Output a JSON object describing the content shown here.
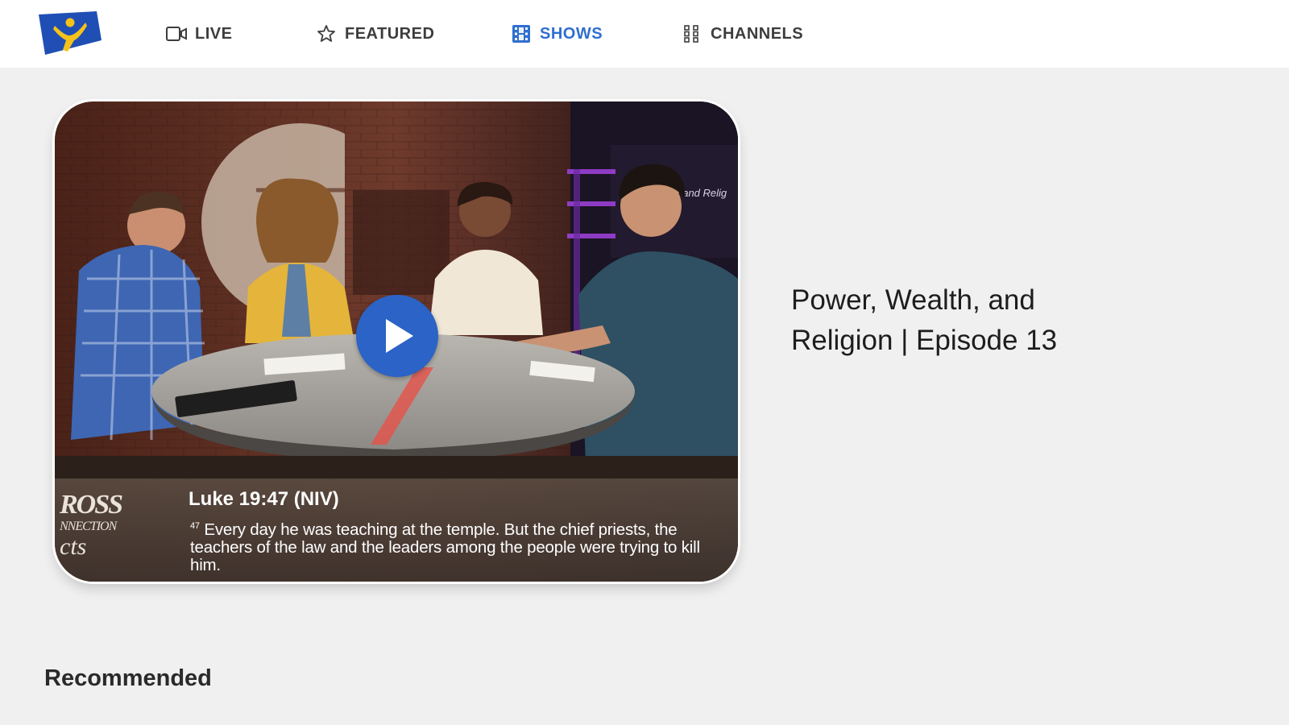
{
  "nav": {
    "logo_icon": "network-logo-icon",
    "items": [
      {
        "label": "LIVE",
        "icon": "video-camera-icon",
        "active": false
      },
      {
        "label": "FEATURED",
        "icon": "star-icon",
        "active": false
      },
      {
        "label": "SHOWS",
        "icon": "film-icon",
        "active": true
      },
      {
        "label": "CHANNELS",
        "icon": "grid-icon",
        "active": false
      }
    ],
    "active_color": "#2f6fd0",
    "text_color": "#3d3d3d"
  },
  "hero": {
    "caption": {
      "brand_line1": "ROSS",
      "brand_line2": "NNECTION",
      "brand_line3": "cts",
      "reference": "Luke 19:47 (NIV)",
      "verse_number": "47",
      "verse": "Every day he was teaching at the temple. But the chief priests, the teachers of the law and the leaders among the people were trying to kill him."
    },
    "set_sign": "t and Relig",
    "play_icon": "play-icon",
    "play_color": "#2b63c6"
  },
  "show": {
    "title": "Power, Wealth, and Religion | Episode 13"
  },
  "sections": {
    "recommended": "Recommended"
  }
}
